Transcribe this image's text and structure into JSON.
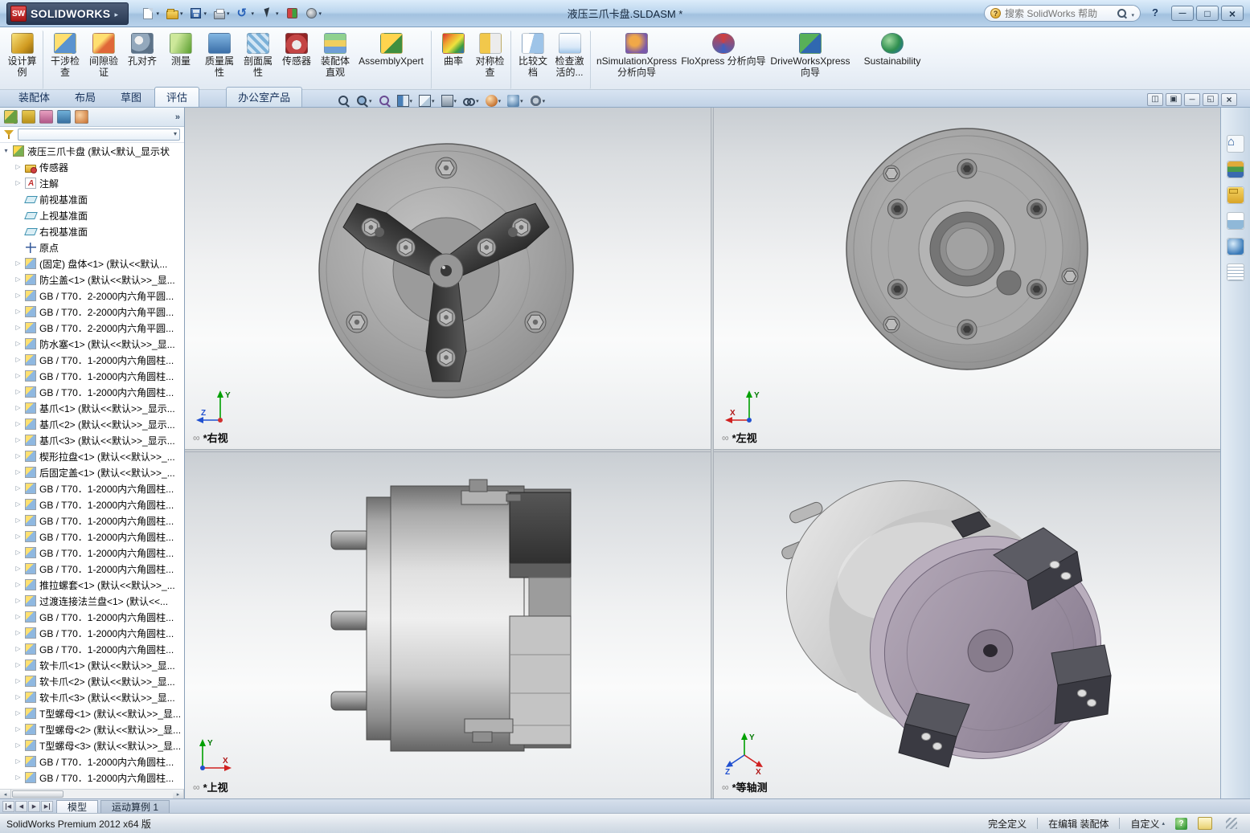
{
  "titlebar": {
    "logo_text": "SW",
    "brand": "SOLIDWORKS",
    "title": "液压三爪卡盘.SLDASM *",
    "search_placeholder": "搜索 SolidWorks 帮助",
    "tool_icons": [
      {
        "icon": "new",
        "cls": "dd"
      },
      {
        "icon": "open",
        "cls": "dd"
      },
      {
        "icon": "save",
        "cls": "dd"
      },
      {
        "icon": "print",
        "cls": "dd"
      },
      {
        "icon": "undo",
        "cls": "dd"
      },
      {
        "icon": "select",
        "cls": "dd"
      },
      {
        "icon": "rebuild"
      },
      {
        "icon": "options",
        "cls": "dd"
      }
    ]
  },
  "ribbon": {
    "buttons": [
      {
        "icon": "design-study",
        "label": "设计算例",
        "cls": "sep-r"
      },
      {
        "icon": "interference",
        "label": "干涉检查"
      },
      {
        "icon": "clearance",
        "label": "间隙验证"
      },
      {
        "icon": "hole-align",
        "label": "孔对齐"
      },
      {
        "icon": "measure",
        "label": "测量"
      },
      {
        "icon": "mass-props",
        "label": "质量属性"
      },
      {
        "icon": "section-props",
        "label": "剖面属性"
      },
      {
        "icon": "sensor",
        "label": "传感器"
      },
      {
        "icon": "assembly-vis",
        "label": "装配体直观"
      },
      {
        "icon": "assemblyxpert",
        "label": "AssemblyXpert",
        "cls": "wide sep-r"
      },
      {
        "icon": "curvature",
        "label": "曲率"
      },
      {
        "icon": "symmetry",
        "label": "对称检查",
        "cls": "sep-r"
      },
      {
        "icon": "compare-doc",
        "label": "比较文档"
      },
      {
        "icon": "check-active",
        "label": "检查激活的...",
        "cls": "sep-r"
      },
      {
        "icon": "simulationxpress",
        "label": "nSimulationXpress 分析向导",
        "cls": "wide2"
      },
      {
        "icon": "floxpress",
        "label": "FloXpress 分析向导",
        "cls": "wide2"
      },
      {
        "icon": "driveworksxpress",
        "label": "DriveWorksXpress 向导",
        "cls": "wide2"
      },
      {
        "icon": "sustainability",
        "label": "Sustainability",
        "cls": "wide"
      }
    ]
  },
  "tabstrip": {
    "tabs": [
      {
        "label": "装配体"
      },
      {
        "label": "布局"
      },
      {
        "label": "草图"
      },
      {
        "label": "评估",
        "cls": "active"
      }
    ],
    "office_tab": "办公室产品"
  },
  "panel": {
    "collapse": "»",
    "tab_icons": [
      {
        "icon": "featuremanager"
      },
      {
        "icon": "propertymanager"
      },
      {
        "icon": "configmanager"
      },
      {
        "icon": "dimxpert"
      },
      {
        "icon": "displaymanager"
      }
    ]
  },
  "feature_tree": {
    "root": "液压三爪卡盘 (默认<默认_显示状",
    "items": [
      {
        "cls": "exp",
        "icon": "sensors",
        "label": "传感器"
      },
      {
        "cls": "exp",
        "icon": "notes",
        "label": "注解"
      },
      {
        "icon": "plane",
        "label": "前视基准面"
      },
      {
        "icon": "plane",
        "label": "上视基准面"
      },
      {
        "icon": "plane",
        "label": "右视基准面"
      },
      {
        "icon": "origin",
        "label": "原点"
      },
      {
        "cls": "exp",
        "icon": "part",
        "label": "(固定) 盘体<1> (默认<<默认..."
      },
      {
        "cls": "exp",
        "icon": "part",
        "label": "防尘盖<1> (默认<<默认>>_显..."
      },
      {
        "cls": "exp",
        "icon": "part",
        "label": "GB / T70．2-2000内六角平圆..."
      },
      {
        "cls": "exp",
        "icon": "part",
        "label": "GB / T70．2-2000内六角平圆..."
      },
      {
        "cls": "exp",
        "icon": "part",
        "label": "GB / T70．2-2000内六角平圆..."
      },
      {
        "cls": "exp",
        "icon": "part",
        "label": "防水塞<1> (默认<<默认>>_显..."
      },
      {
        "cls": "exp",
        "icon": "part",
        "label": "GB / T70．1-2000内六角圆柱..."
      },
      {
        "cls": "exp",
        "icon": "part",
        "label": "GB / T70．1-2000内六角圆柱..."
      },
      {
        "cls": "exp",
        "icon": "part",
        "label": "GB / T70．1-2000内六角圆柱..."
      },
      {
        "cls": "exp",
        "icon": "part",
        "label": "基爪<1> (默认<<默认>>_显示..."
      },
      {
        "cls": "exp",
        "icon": "part",
        "label": "基爪<2> (默认<<默认>>_显示..."
      },
      {
        "cls": "exp",
        "icon": "part",
        "label": "基爪<3> (默认<<默认>>_显示..."
      },
      {
        "cls": "exp",
        "icon": "part",
        "label": "楔形拉盘<1> (默认<<默认>>_..."
      },
      {
        "cls": "exp",
        "icon": "part",
        "label": "后固定盖<1> (默认<<默认>>_..."
      },
      {
        "cls": "exp",
        "icon": "part",
        "label": "GB / T70．1-2000内六角圆柱..."
      },
      {
        "cls": "exp",
        "icon": "part",
        "label": "GB / T70．1-2000内六角圆柱..."
      },
      {
        "cls": "exp",
        "icon": "part",
        "label": "GB / T70．1-2000内六角圆柱..."
      },
      {
        "cls": "exp",
        "icon": "part",
        "label": "GB / T70．1-2000内六角圆柱..."
      },
      {
        "cls": "exp",
        "icon": "part",
        "label": "GB / T70．1-2000内六角圆柱..."
      },
      {
        "cls": "exp",
        "icon": "part",
        "label": "GB / T70．1-2000内六角圆柱..."
      },
      {
        "cls": "exp",
        "icon": "part",
        "label": "推拉螺套<1> (默认<<默认>>_..."
      },
      {
        "cls": "exp",
        "icon": "part",
        "label": "过渡连接法兰盘<1> (默认<<..."
      },
      {
        "cls": "exp",
        "icon": "part",
        "label": "GB / T70．1-2000内六角圆柱..."
      },
      {
        "cls": "exp",
        "icon": "part",
        "label": "GB / T70．1-2000内六角圆柱..."
      },
      {
        "cls": "exp",
        "icon": "part",
        "label": "GB / T70．1-2000内六角圆柱..."
      },
      {
        "cls": "exp",
        "icon": "part",
        "label": "软卡爪<1> (默认<<默认>>_显..."
      },
      {
        "cls": "exp",
        "icon": "part",
        "label": "软卡爪<2> (默认<<默认>>_显..."
      },
      {
        "cls": "exp",
        "icon": "part",
        "label": "软卡爪<3> (默认<<默认>>_显..."
      },
      {
        "cls": "exp",
        "icon": "part",
        "label": "T型螺母<1> (默认<<默认>>_显..."
      },
      {
        "cls": "exp",
        "icon": "part",
        "label": "T型螺母<2> (默认<<默认>>_显..."
      },
      {
        "cls": "exp",
        "icon": "part",
        "label": "T型螺母<3> (默认<<默认>>_显..."
      },
      {
        "cls": "exp",
        "icon": "part",
        "label": "GB / T70．1-2000内六角圆柱..."
      },
      {
        "cls": "exp",
        "icon": "part",
        "label": "GB / T70．1-2000内六角圆柱..."
      }
    ]
  },
  "viewport": {
    "labels": {
      "tl": "*右视",
      "tr": "*左视",
      "bl": "*上视",
      "br": "*等轴测"
    },
    "hud_icons": [
      {
        "icon": "mag"
      },
      {
        "icon": "mag2",
        "cls": "dd"
      },
      {
        "icon": "magp"
      },
      {
        "icon": "section",
        "cls": "dd"
      },
      {
        "icon": "orient",
        "cls": "dd"
      },
      {
        "icon": "display",
        "cls": "dd"
      },
      {
        "icon": "glasses",
        "cls": "dd"
      },
      {
        "icon": "sphere",
        "cls": "dd"
      },
      {
        "icon": "scene",
        "cls": "dd"
      },
      {
        "icon": "gear",
        "cls": "dd"
      }
    ],
    "window_controls": [
      {
        "icon": "tile"
      },
      {
        "icon": "restore"
      },
      {
        "icon": "minimize"
      },
      {
        "icon": "maximize"
      },
      {
        "icon": "close"
      }
    ]
  },
  "axes": {
    "x": "X",
    "y": "Y",
    "z": "Z"
  },
  "taskpane": {
    "icons": [
      {
        "icon": "home"
      },
      {
        "icon": "library"
      },
      {
        "icon": "explorer"
      },
      {
        "icon": "palette"
      },
      {
        "icon": "appearances"
      },
      {
        "icon": "custom-props"
      }
    ]
  },
  "bottom_tabs": {
    "model": "模型",
    "motion": "运动算例 1"
  },
  "statusbar": {
    "app": "SolidWorks Premium 2012 x64 版",
    "state": "完全定义",
    "mode": "在编辑 装配体",
    "custom": "自定义"
  }
}
